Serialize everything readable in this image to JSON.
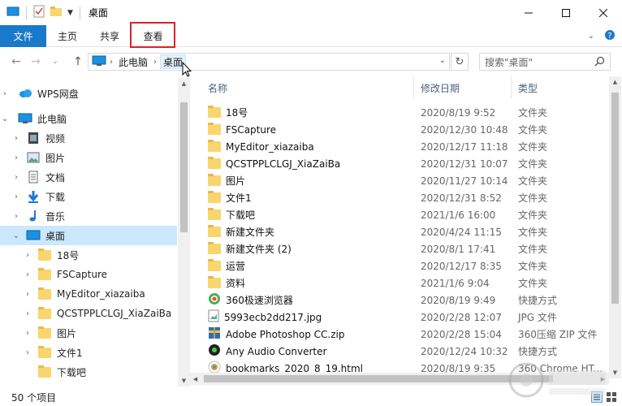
{
  "window": {
    "title": "桌面",
    "controls": [
      "minimize",
      "maximize",
      "close"
    ]
  },
  "ribbon": {
    "tabs": [
      {
        "label": "文件"
      },
      {
        "label": "主页"
      },
      {
        "label": "共享"
      },
      {
        "label": "查看"
      }
    ]
  },
  "address": {
    "segments": [
      "此电脑",
      "桌面"
    ],
    "search_placeholder": "搜索\"桌面\""
  },
  "nav": {
    "items": [
      {
        "label": "WPS网盘",
        "icon": "cloud-icon"
      },
      {
        "label": "此电脑",
        "icon": "computer-icon"
      },
      {
        "label": "视频",
        "icon": "video-icon"
      },
      {
        "label": "图片",
        "icon": "pictures-icon"
      },
      {
        "label": "文档",
        "icon": "documents-icon"
      },
      {
        "label": "下载",
        "icon": "download-icon"
      },
      {
        "label": "音乐",
        "icon": "music-icon"
      },
      {
        "label": "桌面",
        "icon": "desktop-icon",
        "selected": true
      },
      {
        "label": "18号",
        "icon": "folder-icon"
      },
      {
        "label": "FSCapture",
        "icon": "folder-icon"
      },
      {
        "label": "MyEditor_xiazaiba",
        "icon": "folder-icon"
      },
      {
        "label": "QCSTPPLCLGJ_XiaZaiBa",
        "icon": "folder-icon"
      },
      {
        "label": "图片",
        "icon": "folder-icon"
      },
      {
        "label": "文件1",
        "icon": "folder-icon"
      },
      {
        "label": "下载吧",
        "icon": "folder-icon"
      }
    ]
  },
  "files": {
    "columns": [
      "名称",
      "修改日期",
      "类型"
    ],
    "rows": [
      {
        "name": "18号",
        "date": "2020/8/19 9:52",
        "type": "文件夹",
        "icon": "folder-icon"
      },
      {
        "name": "FSCapture",
        "date": "2020/12/30 10:48",
        "type": "文件夹",
        "icon": "folder-icon"
      },
      {
        "name": "MyEditor_xiazaiba",
        "date": "2020/12/17 11:18",
        "type": "文件夹",
        "icon": "folder-icon"
      },
      {
        "name": "QCSTPPLCLGJ_XiaZaiBa",
        "date": "2020/12/31 10:07",
        "type": "文件夹",
        "icon": "folder-icon"
      },
      {
        "name": "图片",
        "date": "2020/11/27 10:14",
        "type": "文件夹",
        "icon": "folder-icon"
      },
      {
        "name": "文件1",
        "date": "2020/12/31 8:52",
        "type": "文件夹",
        "icon": "folder-icon"
      },
      {
        "name": "下载吧",
        "date": "2021/1/6 16:00",
        "type": "文件夹",
        "icon": "folder-icon"
      },
      {
        "name": "新建文件夹",
        "date": "2020/4/24 11:15",
        "type": "文件夹",
        "icon": "folder-icon"
      },
      {
        "name": "新建文件夹 (2)",
        "date": "2020/8/1 17:41",
        "type": "文件夹",
        "icon": "folder-icon"
      },
      {
        "name": "运营",
        "date": "2020/12/17 8:35",
        "type": "文件夹",
        "icon": "folder-icon"
      },
      {
        "name": "资料",
        "date": "2021/1/6 9:04",
        "type": "文件夹",
        "icon": "folder-icon"
      },
      {
        "name": "360极速浏览器",
        "date": "2020/8/19 9:49",
        "type": "快捷方式",
        "icon": "browser-360-icon"
      },
      {
        "name": "5993ecb2dd217.jpg",
        "date": "2020/2/28 12:07",
        "type": "JPG 文件",
        "icon": "image-file-icon"
      },
      {
        "name": "Adobe Photoshop CC.zip",
        "date": "2020/2/28 15:04",
        "type": "360压缩 ZIP 文件",
        "icon": "zip-icon"
      },
      {
        "name": "Any Audio Converter",
        "date": "2020/12/24 10:32",
        "type": "快捷方式",
        "icon": "audio-converter-icon"
      },
      {
        "name": "bookmarks_2020_8_19.html",
        "date": "2020/8/19 9:35",
        "type": "360 Chrome HT...",
        "icon": "html-file-icon"
      }
    ]
  },
  "status": {
    "count": "50 个项目"
  },
  "colors": {
    "file_tab": "#1979ca",
    "selection": "#cce8ff",
    "highlight": "#d8242a",
    "folder": "#f9d56e"
  }
}
